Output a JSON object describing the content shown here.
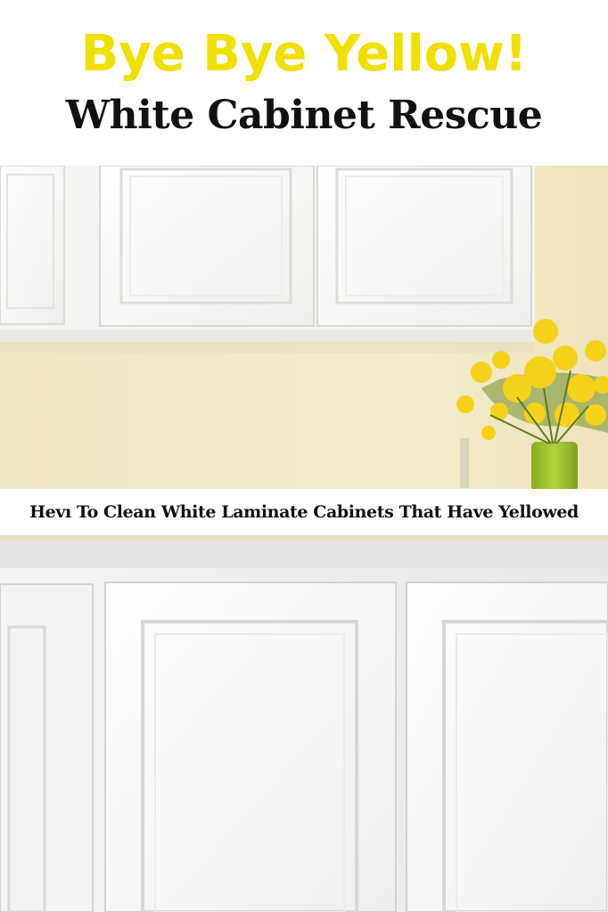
{
  "header": {
    "headline": "Bye Bye Yellow!",
    "subhead": "White Cabinet Rescue"
  },
  "caption": {
    "text": "Hevı To Clean White Laminate Cabinets That Have Yellowed"
  },
  "colors": {
    "headline_yellow": "#f0e000",
    "wall": "#f1e8c6",
    "cabinet_white": "#f7f7f5",
    "flower_yellow": "#f5d21a",
    "vase_green": "#9bbe2a"
  },
  "photo": {
    "subject": "white-cabinets-with-yellow-flowers"
  }
}
